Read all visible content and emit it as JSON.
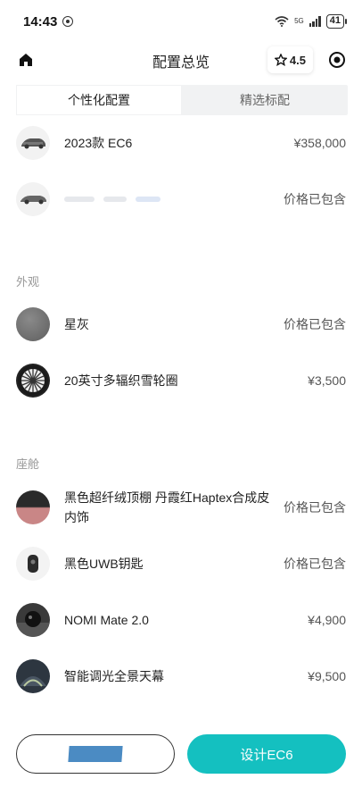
{
  "status_bar": {
    "time": "14:43",
    "network": "5G",
    "battery": "41"
  },
  "header": {
    "title": "配置总览",
    "rating": "4.5",
    "icons": [
      "home-icon",
      "star-icon",
      "target-icon"
    ]
  },
  "tabs": [
    {
      "label": "个性化配置",
      "active": true
    },
    {
      "label": "精选标配",
      "active": false
    }
  ],
  "base_items": [
    {
      "label": "2023款 EC6",
      "price": "¥358,000"
    },
    {
      "label": "",
      "price": "价格已包含"
    }
  ],
  "sections": {
    "exterior_title": "外观",
    "cabin_title": "座舱"
  },
  "exterior_items": [
    {
      "label": "星灰",
      "price": "价格已包含"
    },
    {
      "label": "20英寸多辐织雪轮圈",
      "price": "¥3,500"
    }
  ],
  "cabin_items": [
    {
      "label": "黑色超纤绒顶棚 丹霞红Haptex合成皮内饰",
      "price": "价格已包含"
    },
    {
      "label": "黑色UWB钥匙",
      "price": "价格已包含"
    },
    {
      "label": "NOMI Mate 2.0",
      "price": "¥4,900"
    },
    {
      "label": "智能调光全景天幕",
      "price": "¥9,500"
    }
  ],
  "footer": {
    "primary_label": "设计EC6"
  },
  "colors": {
    "accent": "#14c0c0",
    "tab_bg": "#f1f2f3"
  }
}
